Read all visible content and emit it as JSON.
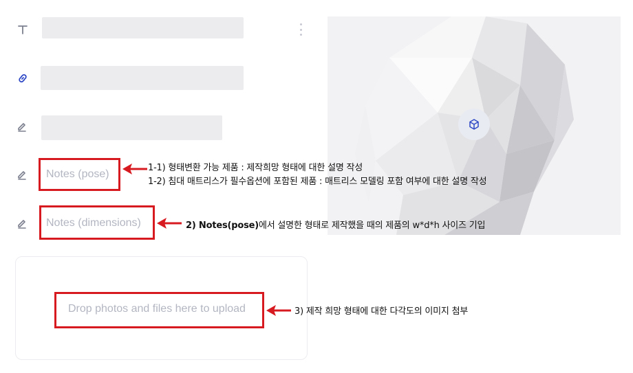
{
  "fields": {
    "notes_pose": {
      "placeholder": "Notes (pose)"
    },
    "notes_dimensions": {
      "placeholder": "Notes (dimensions)"
    }
  },
  "upload": {
    "label": "Drop photos and files here to upload"
  },
  "annotations": {
    "pose_line1": "1-1) 형태변환 가능 제품 : 제작희망 형태에 대한 설명 작성",
    "pose_line2": "1-2) 침대 매트리스가 필수옵션에 포함된 제품 : 매트리스 모델링 포함 여부에 대한 설명 작성",
    "dimensions_note_bold": "2) Notes(pose)",
    "dimensions_note_rest": "에서 설명한 형태로 제작했을 때의 제품의 w*d*h 사이즈 기입",
    "upload_note": "3) 제작 희망 형태에 대한 다각도의 이미지 첨부"
  },
  "icons": {
    "title": "text-icon",
    "link": "link-icon",
    "edit": "pencil-icon",
    "more": "kebab-menu-icon",
    "model": "cube-icon"
  },
  "colors": {
    "annotation_red": "#d71920",
    "placeholder": "#b3b6c1",
    "link_icon": "#2f49c6"
  }
}
